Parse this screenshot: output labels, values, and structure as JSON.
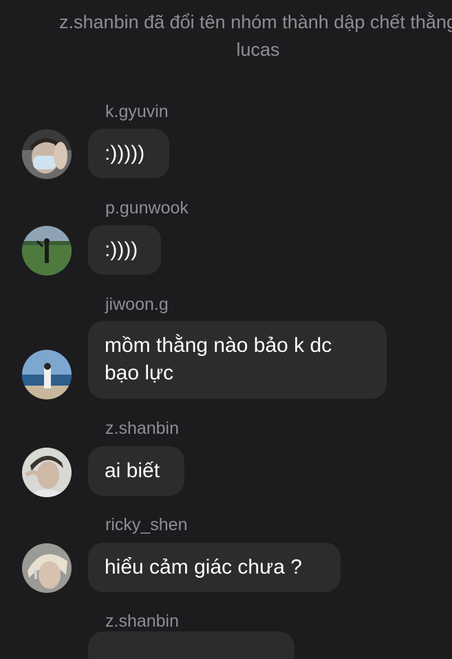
{
  "system_notice": "z.shanbin đã đổi tên nhóm thành dập chết thằng lucas",
  "messages": [
    {
      "sender": "k.gyuvin",
      "text": ":)))))"
    },
    {
      "sender": "p.gunwook",
      "text": ":))))"
    },
    {
      "sender": "jiwoon.g",
      "text": "mồm thằng nào bảo k dc\nbạo lực"
    },
    {
      "sender": "z.shanbin",
      "text": "ai biết"
    },
    {
      "sender": "ricky_shen",
      "text": "hiểu cảm giác chưa ?"
    },
    {
      "sender": "z.shanbin",
      "text": ""
    }
  ],
  "colors": {
    "background": "#1c1c1e",
    "bubble": "#2c2c2e",
    "meta_text": "#8e8e93",
    "text": "#ffffff"
  }
}
